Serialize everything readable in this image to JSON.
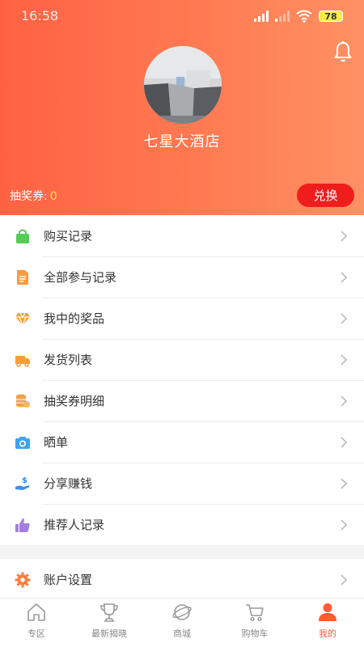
{
  "status_bar": {
    "time": "16:58",
    "battery": "78"
  },
  "profile": {
    "name": "七星大酒店"
  },
  "lottery": {
    "label": "抽奖券:",
    "value": "0"
  },
  "redeem_button": "兑换",
  "menu": [
    {
      "label": "购买记录",
      "icon": "shopping-bag-icon",
      "color": "#55cc55"
    },
    {
      "label": "全部参与记录",
      "icon": "document-icon",
      "color": "#ff9a3c"
    },
    {
      "label": "我中的奖品",
      "icon": "diamond-icon",
      "color": "#f4a03a"
    },
    {
      "label": "发货列表",
      "icon": "truck-icon",
      "color": "#f99c3d"
    },
    {
      "label": "抽奖券明细",
      "icon": "coins-icon",
      "color": "#f2a14a"
    },
    {
      "label": "晒单",
      "icon": "camera-icon",
      "color": "#3ea3f0"
    },
    {
      "label": "分享赚钱",
      "icon": "money-hand-icon",
      "color": "#3b8fe8"
    },
    {
      "label": "推荐人记录",
      "icon": "thumbs-up-icon",
      "color": "#a47ee0"
    }
  ],
  "settings": {
    "label": "账户设置",
    "icon": "gear-icon",
    "color": "#ff7b3a"
  },
  "tabs": [
    {
      "label": "专区",
      "icon": "home-icon"
    },
    {
      "label": "最新揭晓",
      "icon": "trophy-icon"
    },
    {
      "label": "商城",
      "icon": "planet-icon"
    },
    {
      "label": "购物车",
      "icon": "cart-icon"
    },
    {
      "label": "我的",
      "icon": "user-icon",
      "active": true
    }
  ],
  "colors": {
    "header_start": "#ff6243",
    "header_end": "#ff9164",
    "accent": "#f01d1d",
    "active_tab": "#ff5b36"
  }
}
